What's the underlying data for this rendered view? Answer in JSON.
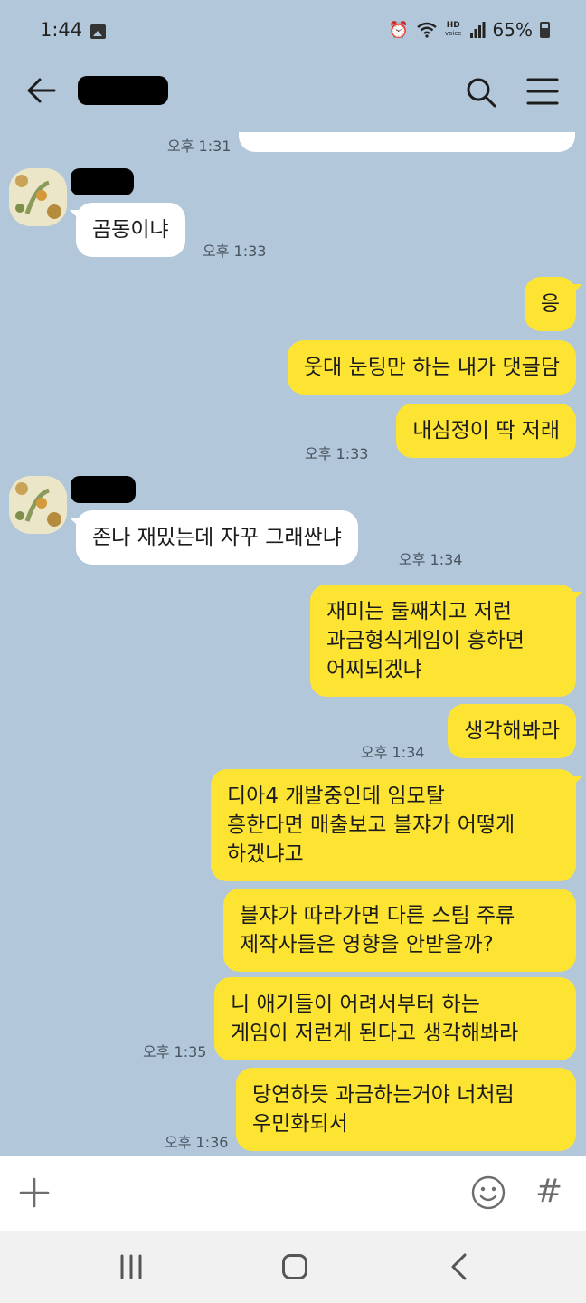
{
  "status_bar": {
    "time": "1:44",
    "battery": "65%",
    "icons": [
      "gallery-icon",
      "alarm-icon",
      "wifi-icon",
      "hd-voice-icon",
      "signal-icon",
      "battery-icon"
    ],
    "hd_label": "HD",
    "voice_label": "voice"
  },
  "header": {
    "title": "",
    "icons": [
      "back-arrow-icon",
      "search-icon",
      "menu-icon"
    ]
  },
  "messages": [
    {
      "from": "me",
      "text": "",
      "time": "오후 1:31"
    },
    {
      "from": "them",
      "sender": "",
      "text": "곰동이냐",
      "time": "오후 1:33"
    },
    {
      "from": "me",
      "text": "응",
      "time": ""
    },
    {
      "from": "me",
      "text": "웃대 눈팅만 하는 내가 댓글담",
      "time": ""
    },
    {
      "from": "me",
      "text": "내심정이 딱 저래",
      "time": "오후 1:33"
    },
    {
      "from": "them",
      "sender": "",
      "text": "존나 재밌는데 자꾸 그래싼냐",
      "time": "오후 1:34"
    },
    {
      "from": "me",
      "text": "재미는 둘째치고 저런\n과금형식게임이 흥하면\n어찌되겠냐",
      "time": ""
    },
    {
      "from": "me",
      "text": "생각해봐라",
      "time": "오후 1:34"
    },
    {
      "from": "me",
      "text": "디아4 개발중인데 임모탈\n흥한다면 매출보고 블쟈가 어떻게\n하겠냐고",
      "time": ""
    },
    {
      "from": "me",
      "text": "블쟈가 따라가면 다른 스팀 주류\n제작사들은 영향을 안받을까?",
      "time": ""
    },
    {
      "from": "me",
      "text": "니 애기들이 어려서부터 하는\n게임이 저런게 된다고 생각해봐라",
      "time": "오후 1:35"
    },
    {
      "from": "me",
      "text": "당연하듯 과금하는거야 너처럼\n우민화되서",
      "time": "오후 1:36"
    }
  ],
  "input_bar": {
    "icons": [
      "plus-icon",
      "emoji-icon",
      "hash-icon"
    ],
    "hash_label": "#"
  },
  "nav_bar": {
    "icons": [
      "recent-apps-icon",
      "home-icon",
      "back-icon"
    ]
  },
  "colors": {
    "background": "#b2c7da",
    "my_bubble": "#fde433",
    "their_bubble": "#ffffff"
  }
}
